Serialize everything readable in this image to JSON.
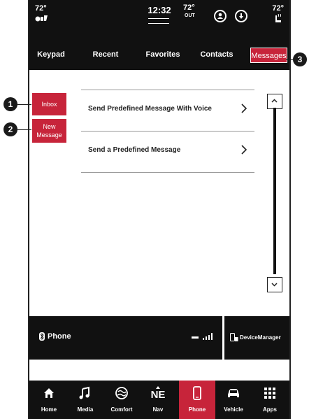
{
  "status_bar": {
    "left_temp": "72°",
    "time": "12:32",
    "outside_temp": "72°",
    "outside_label": "OUT",
    "right_temp": "72°",
    "icons": [
      "seat-heat-icon",
      "profile-icon",
      "download-icon",
      "seat-heat-icon"
    ]
  },
  "tabs": [
    {
      "label": "Keypad"
    },
    {
      "label": "Recent"
    },
    {
      "label": "Favorites"
    },
    {
      "label": "Contacts"
    },
    {
      "label": "Messages",
      "active": true
    }
  ],
  "side_buttons": {
    "inbox": "Inbox",
    "new_message": "New Message"
  },
  "messages": [
    {
      "label": "Send Predefined Message With Voice"
    },
    {
      "label": "Send a Predefined Message"
    }
  ],
  "phone_bar": {
    "label": "Phone",
    "device_manager": "DeviceManager"
  },
  "bottom_nav": [
    {
      "label": "Home",
      "icon": "home-icon"
    },
    {
      "label": "Media",
      "icon": "music-note-icon"
    },
    {
      "label": "Comfort",
      "icon": "comfort-icon"
    },
    {
      "label": "Nav",
      "icon": "compass-icon",
      "heading": "NE"
    },
    {
      "label": "Phone",
      "icon": "phone-icon",
      "active": true
    },
    {
      "label": "Vehicle",
      "icon": "car-icon"
    },
    {
      "label": "Apps",
      "icon": "apps-grid-icon"
    }
  ],
  "callouts": [
    "1",
    "2",
    "3"
  ],
  "colors": {
    "accent": "#c7243a",
    "dark": "#111111"
  }
}
